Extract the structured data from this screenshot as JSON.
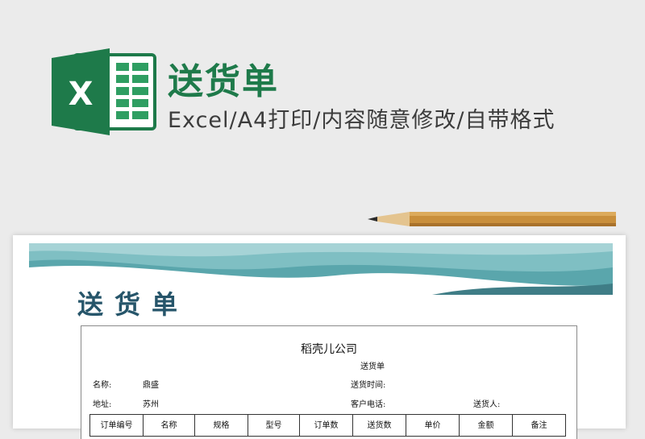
{
  "banner": {
    "title": "送货单",
    "subtitle": "Excel/A4打印/内容随意修改/自带格式",
    "logo_letter": "X",
    "colors": {
      "excel_green": "#1e7a4a",
      "heading_teal": "#26556a",
      "wave": "#5aa6ac"
    }
  },
  "document": {
    "heading": "送货单",
    "company": "稻壳儿公司",
    "doc_type": "送货单",
    "fields": {
      "name_label": "名称:",
      "name_value": "鼎盛",
      "address_label": "地址:",
      "address_value": "苏州",
      "delivery_time_label": "送货时间:",
      "customer_phone_label": "客户电话:",
      "deliverer_label": "送货人:"
    },
    "table_headers": [
      "订单编号",
      "名称",
      "规格",
      "型号",
      "订单数",
      "送货数",
      "单价",
      "金额",
      "备注"
    ]
  }
}
